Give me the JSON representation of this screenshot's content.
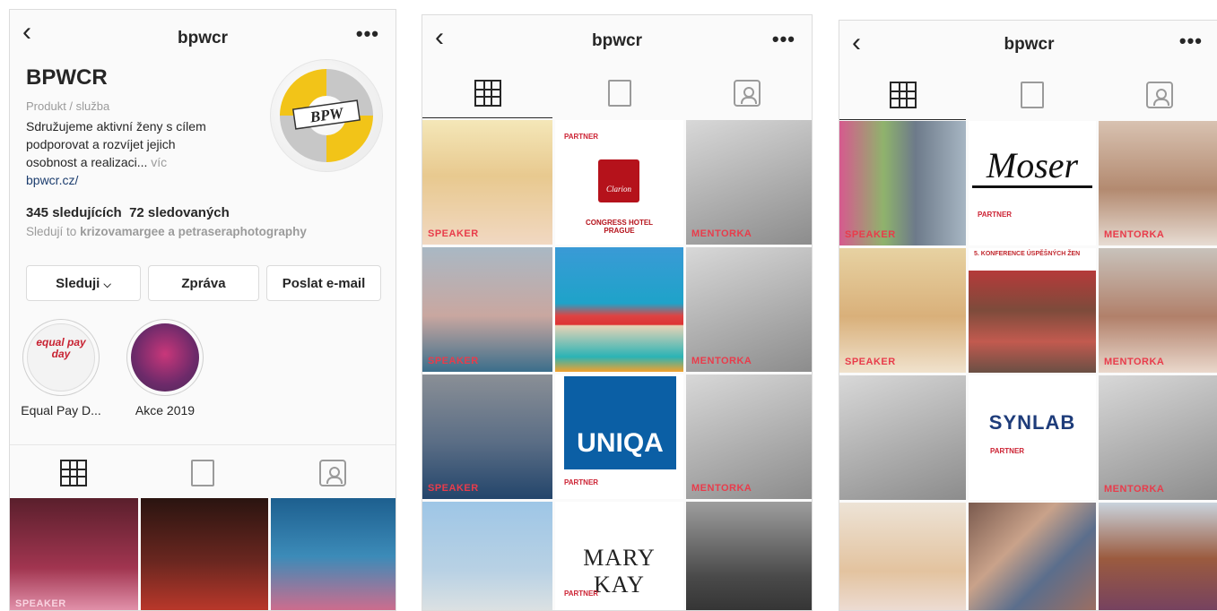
{
  "username": "bpwcr",
  "profile": {
    "name": "BPWCR",
    "category": "Produkt / služba",
    "bio_lines": [
      "Sdružujeme aktivní ženy s cílem",
      "podporovat a rozvíjet jejich"
    ],
    "bio_last": "osobnost a realizaci...",
    "more": "víc",
    "link": "bpwcr.cz/",
    "followers": "345 sledujících",
    "following": "72 sledovaných",
    "followed_by_prefix": "Sledují to",
    "followed_by_names": "krizovamargee a petraseraphotography",
    "logo_text": "BPW"
  },
  "actions": {
    "follow": "Sleduji",
    "message": "Zpráva",
    "email": "Poslat e-mail"
  },
  "highlights": [
    {
      "caption": "Equal Pay D...",
      "art": "equal pay day"
    },
    {
      "caption": "Akce 2019"
    }
  ],
  "tiles": {
    "speaker": "SPEAKER",
    "mentorka": "MENTORKA",
    "partner": "PARTNER",
    "clarion": "Clarion",
    "congress": "CONGRESS HOTEL PRAGUE",
    "uniqa": "UNIQA",
    "marykay": "MARY KAY",
    "moser": "Moser",
    "synlab": "SYNLAB",
    "konference": "5. KONFERENCE ÚSPĚŠNÝCH ŽEN"
  },
  "colors": {
    "accent": "#e83c4b",
    "link": "#1c3d6e",
    "uniqa_blue": "#0b5fa5"
  },
  "icons": [
    "back-icon",
    "more-icon",
    "grid-icon",
    "feed-icon",
    "tagged-icon",
    "chevron-down-icon"
  ]
}
